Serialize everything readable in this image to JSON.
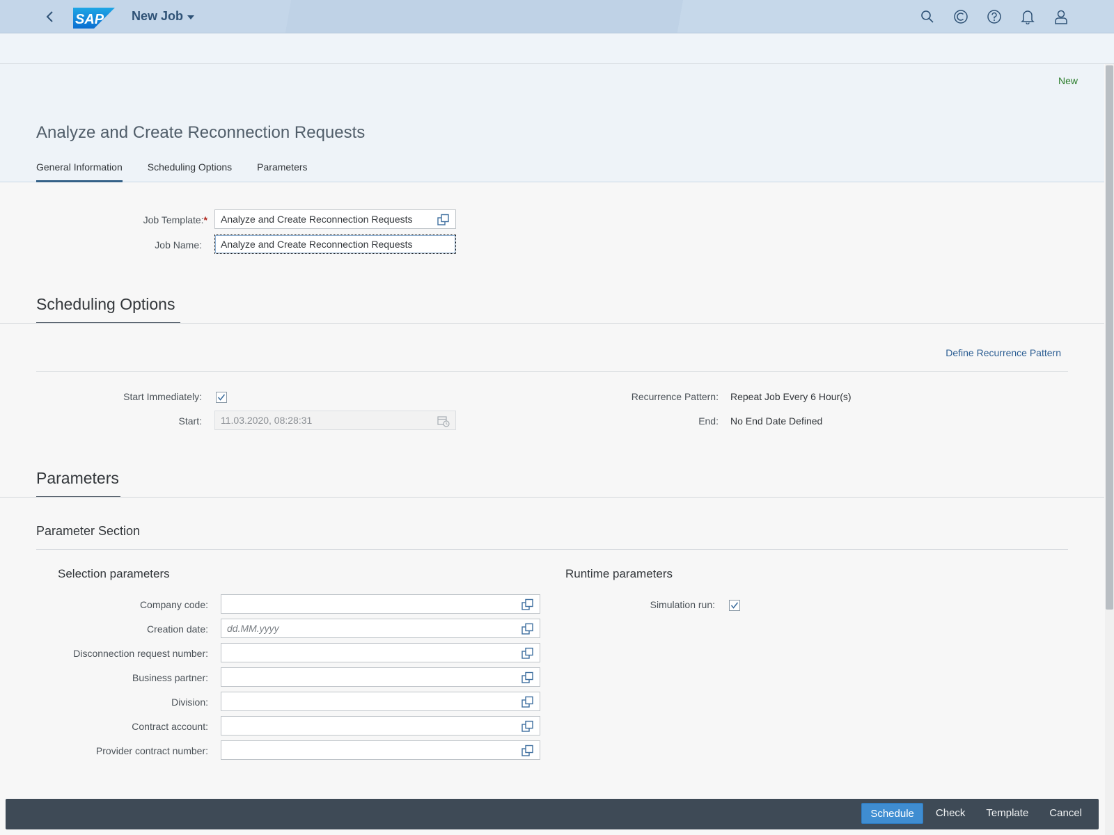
{
  "shell": {
    "app_title": "New Job",
    "logo_text": "SAP",
    "icons": [
      "search-icon",
      "copilot-icon",
      "help-icon",
      "notifications-icon",
      "user-icon"
    ]
  },
  "header": {
    "status": "New",
    "title": "Analyze and Create Reconnection Requests",
    "tabs": [
      {
        "label": "General Information",
        "active": true
      },
      {
        "label": "Scheduling Options",
        "active": false
      },
      {
        "label": "Parameters",
        "active": false
      }
    ]
  },
  "general": {
    "job_template_label": "Job Template:",
    "required_mark": "*",
    "job_template_value": "Analyze and Create Reconnection Requests",
    "job_name_label": "Job Name:",
    "job_name_value": "Analyze and Create Reconnection Requests"
  },
  "scheduling": {
    "section_title": "Scheduling Options",
    "define_recurrence_link": "Define Recurrence Pattern",
    "start_immediately_label": "Start Immediately:",
    "start_immediately_checked": true,
    "start_label": "Start:",
    "start_value": "11.03.2020, 08:28:31",
    "recurrence_label": "Recurrence Pattern:",
    "recurrence_value": "Repeat Job Every 6 Hour(s)",
    "end_label": "End:",
    "end_value": "No End Date Defined"
  },
  "parameters": {
    "section_title": "Parameters",
    "subsection_title": "Parameter Section",
    "selection_title": "Selection parameters",
    "runtime_title": "Runtime parameters",
    "fields": [
      {
        "label": "Company code:",
        "value": "",
        "placeholder": ""
      },
      {
        "label": "Creation date:",
        "value": "",
        "placeholder": "dd.MM.yyyy"
      },
      {
        "label": "Disconnection request number:",
        "value": "",
        "placeholder": ""
      },
      {
        "label": "Business partner:",
        "value": "",
        "placeholder": ""
      },
      {
        "label": "Division:",
        "value": "",
        "placeholder": ""
      },
      {
        "label": "Contract account:",
        "value": "",
        "placeholder": ""
      },
      {
        "label": "Provider contract number:",
        "value": "",
        "placeholder": ""
      }
    ],
    "simulation_run_label": "Simulation run:",
    "simulation_run_checked": true
  },
  "footer": {
    "schedule": "Schedule",
    "check": "Check",
    "template": "Template",
    "cancel": "Cancel"
  },
  "colors": {
    "shell_bg": "#c4d6e9",
    "accent": "#346187",
    "footer_bg": "#3e4a56",
    "primary_button": "#3f8dd1",
    "status_green": "#2b7d2b"
  }
}
